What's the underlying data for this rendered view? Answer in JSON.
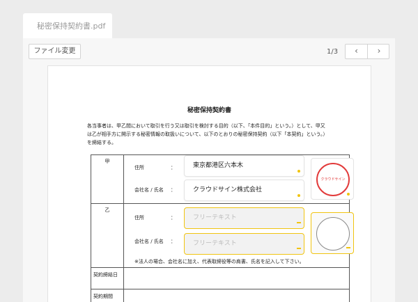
{
  "tab": {
    "filename": "秘密保持契約書.pdf"
  },
  "toolbar": {
    "file_change_label": "ファイル変更",
    "page_indicator": "1/3",
    "prev_icon": "‹",
    "next_icon": "›"
  },
  "document": {
    "title": "秘密保持契約書",
    "body_line1": "各当事者は、甲乙間において取引を行う又は取引を検討する目的（以下、「本件目的」という。）として、甲又",
    "body_line2": "は乙が相手方に開示する秘密情報の取扱いについて、以下のとおりの秘密保持契約（以下「本契約」という。）",
    "body_line3": "を締結する。",
    "party_a_label": "甲",
    "party_b_label": "乙",
    "address_label": "住所",
    "company_label": "会社名 / 氏名",
    "colon": "：",
    "party_a_address": "東京都港区六本木",
    "party_a_company": "クラウドサイン株式会社",
    "party_a_seal_text": "クラウドサイン",
    "party_b_address_placeholder": "フリーテキスト",
    "party_b_company_placeholder": "フリーテキスト",
    "note": "※法人の場合、会社名に加え、代表取締役等の肩書、氏名を記入して下さい。",
    "contract_date_label": "契約締結日",
    "contract_period_label": "契約期間"
  }
}
